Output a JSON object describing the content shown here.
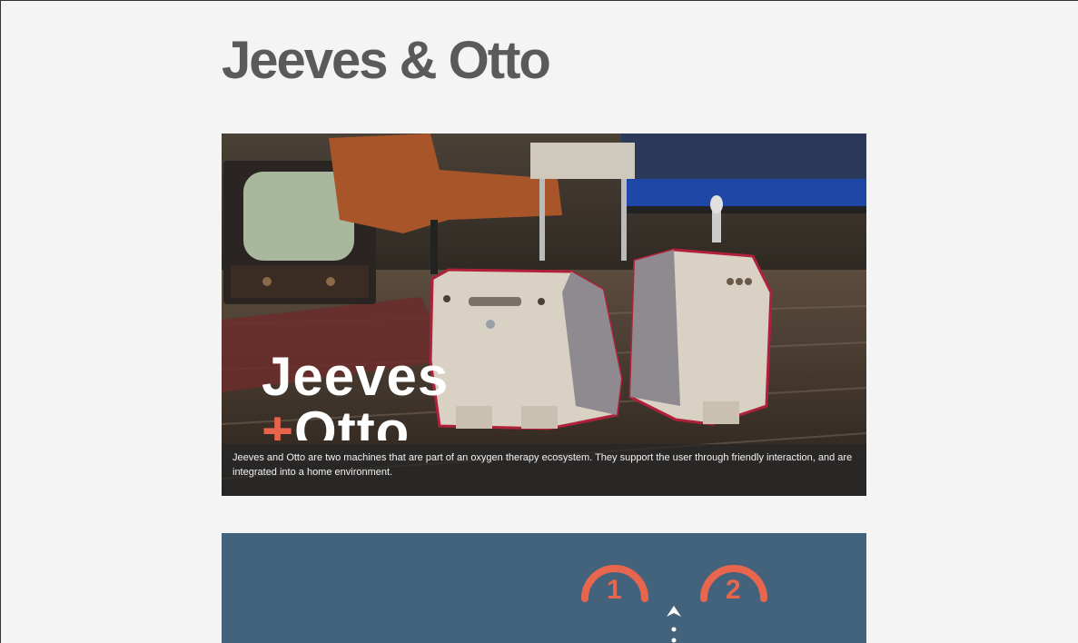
{
  "page": {
    "title": "Jeeves & Otto"
  },
  "hero": {
    "logo_line1": "Jeeves",
    "logo_plus": "+",
    "logo_line2": "Otto",
    "caption": "Jeeves and Otto are two machines that are part of an oxygen therapy ecosystem. They support the user through friendly interaction, and are integrated into a home environment."
  },
  "panel": {
    "step1": "1",
    "step2": "2",
    "accent_color": "#e8664e",
    "background_color": "#43637c"
  },
  "icons": [
    "up-arrow-icon"
  ]
}
